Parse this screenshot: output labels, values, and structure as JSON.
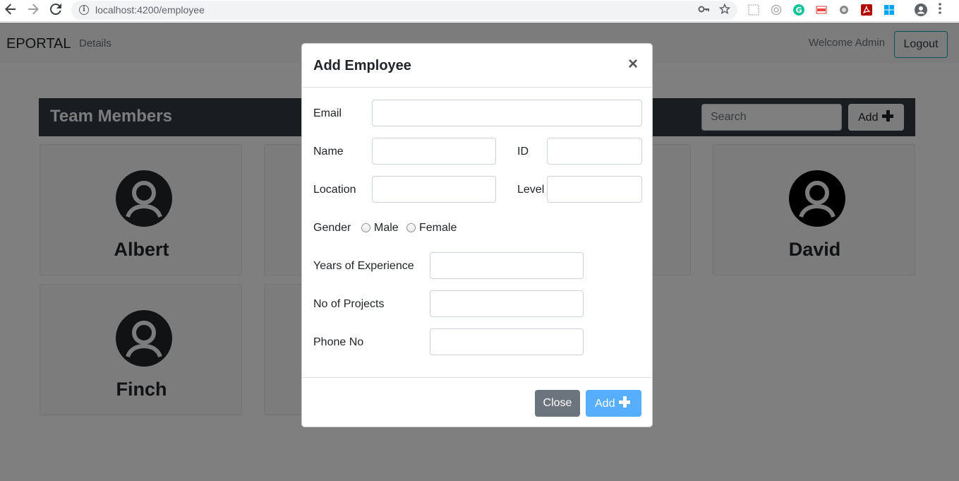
{
  "browser": {
    "url": "localhost:4200/employee",
    "icons": [
      "back-arrow",
      "forward-arrow",
      "reload",
      "site-info",
      "key",
      "star",
      "extension-1",
      "extension-2",
      "grammarly",
      "extension-4",
      "extension-5",
      "acrobat",
      "windows",
      "profile",
      "menu"
    ]
  },
  "navbar": {
    "brand": "EPORTAL",
    "link_details": "Details",
    "welcome": "Welcome Admin",
    "logout_label": "Logout"
  },
  "team": {
    "title": "Team Members",
    "search_placeholder": "Search",
    "add_label": "Add",
    "members": [
      {
        "name": "Albert"
      },
      {
        "name": "David"
      },
      {
        "name": "Finch"
      }
    ]
  },
  "modal": {
    "title": "Add Employee",
    "close_symbol": "×",
    "labels": {
      "email": "Email",
      "name": "Name",
      "id": "ID",
      "location": "Location",
      "level": "Level",
      "gender": "Gender",
      "male": "Male",
      "female": "Female",
      "years_experience": "Years of Experience",
      "projects": "No of Projects",
      "phone": "Phone No"
    },
    "values": {
      "email": "",
      "name": "",
      "id": "",
      "location": "",
      "level": "",
      "years_experience": "",
      "projects": "",
      "phone": ""
    },
    "footer": {
      "close_label": "Close",
      "add_label": "Add"
    }
  },
  "colors": {
    "dark": "#343a40",
    "light": "#f8f9fa",
    "secondary": "#6c757d",
    "primary_faded": "#56aefc",
    "info": "#17a2b8"
  }
}
